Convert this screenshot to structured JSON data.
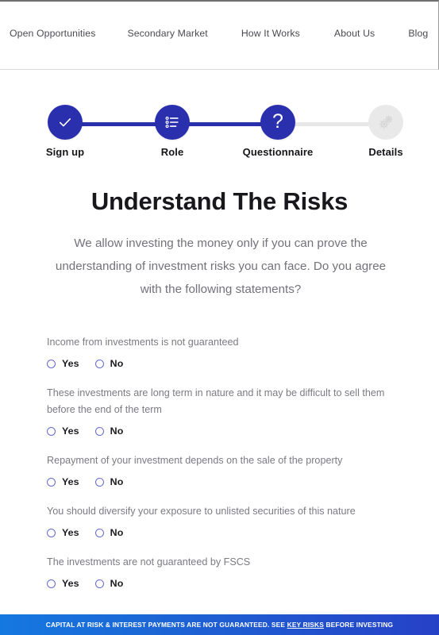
{
  "nav": {
    "items": [
      {
        "label": "Open Opportunities"
      },
      {
        "label": "Secondary Market"
      },
      {
        "label": "How It Works"
      },
      {
        "label": "About Us"
      },
      {
        "label": "Blog"
      }
    ]
  },
  "stepper": {
    "active_color": "#2a2fae",
    "inactive_color": "#e9e9e9",
    "steps": [
      {
        "label": "Sign up",
        "icon": "check-icon",
        "state": "complete"
      },
      {
        "label": "Role",
        "icon": "list-icon",
        "state": "complete"
      },
      {
        "label": "Questionnaire",
        "icon": "question-icon",
        "state": "current"
      },
      {
        "label": "Details",
        "icon": "gears-icon",
        "state": "upcoming"
      }
    ]
  },
  "main": {
    "title": "Understand The Risks",
    "description": "We allow investing the money only if you can prove the understanding of investment risks you can face. Do you agree with the following statements?",
    "questions": [
      {
        "text": "Income from investments is not guaranteed",
        "options": [
          {
            "label": "Yes",
            "selected": false
          },
          {
            "label": "No",
            "selected": false
          }
        ]
      },
      {
        "text": "These investments are long term in nature and it may be difficult to sell them before the end of the term",
        "options": [
          {
            "label": "Yes",
            "selected": false
          },
          {
            "label": "No",
            "selected": false
          }
        ]
      },
      {
        "text": "Repayment of your investment depends on the sale of the property",
        "options": [
          {
            "label": "Yes",
            "selected": false
          },
          {
            "label": "No",
            "selected": false
          }
        ]
      },
      {
        "text": "You should diversify your exposure to unlisted securities of this nature",
        "options": [
          {
            "label": "Yes",
            "selected": false
          },
          {
            "label": "No",
            "selected": false
          }
        ]
      },
      {
        "text": "The investments are not guaranteed by FSCS",
        "options": [
          {
            "label": "Yes",
            "selected": false
          },
          {
            "label": "No",
            "selected": false
          }
        ]
      }
    ]
  },
  "banner": {
    "text_before": "CAPITAL AT RISK & INTEREST PAYMENTS ARE NOT GUARANTEED. SEE ",
    "link_text": "KEY RISKS",
    "text_after": " BEFORE INVESTING",
    "gradient_start": "#1578e0",
    "gradient_end": "#2641c6"
  }
}
